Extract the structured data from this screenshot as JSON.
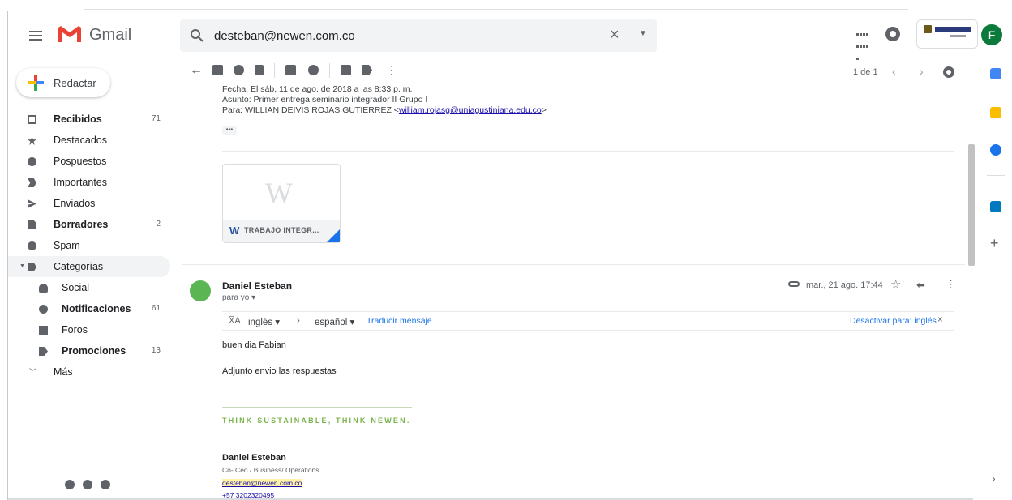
{
  "app": {
    "name": "Gmail"
  },
  "search": {
    "value": "desteban@newen.com.co"
  },
  "profile": {
    "initial": "F"
  },
  "compose": {
    "label": "Redactar"
  },
  "sidebar": {
    "items": [
      {
        "label": "Recibidos",
        "count": "71"
      },
      {
        "label": "Destacados",
        "count": ""
      },
      {
        "label": "Pospuestos",
        "count": ""
      },
      {
        "label": "Importantes",
        "count": ""
      },
      {
        "label": "Enviados",
        "count": ""
      },
      {
        "label": "Borradores",
        "count": "2"
      },
      {
        "label": "Spam",
        "count": ""
      },
      {
        "label": "Categorías",
        "count": ""
      },
      {
        "label": "Social",
        "count": ""
      },
      {
        "label": "Notificaciones",
        "count": "61"
      },
      {
        "label": "Foros",
        "count": ""
      },
      {
        "label": "Promociones",
        "count": "13"
      },
      {
        "label": "Más",
        "count": ""
      }
    ]
  },
  "pager": {
    "label": "1 de 1"
  },
  "forwarded": {
    "date_line": "Fecha: El sáb, 11 de ago. de 2018 a las 8:33 p. m.",
    "subject_line": "Asunto: Primer entrega seminario integrador II Grupo I",
    "to_prefix": "Para: WILLIAN DEIVIS ROJAS GUTIERREZ <",
    "to_email": "william.rojasg@uniagustiniana.edu.co",
    "to_suffix": ">"
  },
  "attachment": {
    "name": "TRABAJO INTEGR..."
  },
  "message": {
    "sender": "Daniel Esteban",
    "to": "para yo",
    "date": "mar., 21 ago. 17:44",
    "greeting": "buen dia Fabian",
    "body": "Adjunto envio las respuestas"
  },
  "translate": {
    "from": "inglés",
    "to": "español",
    "action": "Traducir mensaje",
    "disable": "Desactivar para: inglés"
  },
  "signature": {
    "tagline": "THINK SUSTAINABLE, THINK NEWEN.",
    "name": "Daniel Esteban",
    "role": "Co- Ceo / Business/ Operations",
    "email": "desteban@newen.com.co",
    "phone": "+57 3202320495"
  },
  "colors": {
    "accent_blue": "#1a73e8",
    "gmail_red": "#ea4335",
    "avatar_green": "#0b7a3b",
    "tagline_green": "#79b34a"
  }
}
